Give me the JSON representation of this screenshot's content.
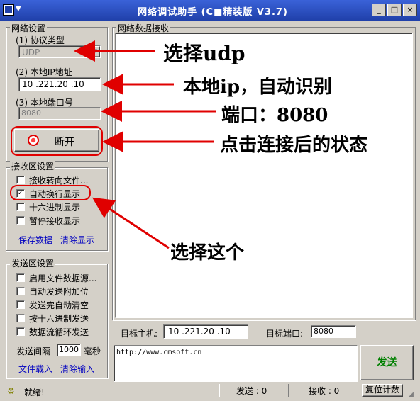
{
  "window": {
    "title": "网络调试助手 (C■精装版 V3.7)"
  },
  "settings": {
    "group_title": "网络设置",
    "protocol_label": "(1) 协议类型",
    "protocol_value": "UDP",
    "local_ip_label": "(2) 本地IP地址",
    "local_ip_value": "10 .221.20 .10",
    "local_port_label": "(3) 本地端口号",
    "local_port_value": "8080",
    "connect_button": "断开"
  },
  "receive": {
    "group_title": "接收区设置",
    "options": [
      "接收转向文件...",
      "自动换行显示",
      "十六进制显示",
      "暂停接收显示"
    ],
    "checked": [
      false,
      true,
      false,
      false
    ],
    "save_link": "保存数据",
    "clear_link": "清除显示"
  },
  "send": {
    "group_title": "发送区设置",
    "options": [
      "启用文件数据源...",
      "自动发送附加位",
      "发送完自动清空",
      "按十六进制发送",
      "数据流循环发送"
    ],
    "checked": [
      false,
      false,
      false,
      false,
      false
    ],
    "interval_label": "发送间隔",
    "interval_value": "1000",
    "interval_unit": "毫秒",
    "load_link": "文件载入",
    "clear_link": "清除输入"
  },
  "data_area": {
    "title": "网络数据接收"
  },
  "target": {
    "host_label": "目标主机:",
    "host_value": "10 .221.20 .10",
    "port_label": "目标端口:",
    "port_value": "8080"
  },
  "send_input": {
    "value": "http://www.cmsoft.cn"
  },
  "send_button": "发送",
  "status": {
    "ready": "就绪!",
    "sent_label": "发送 : 0",
    "recv_label": "接收 : 0",
    "reset_button": "复位计数"
  },
  "annotations": {
    "select_udp": "选择udp",
    "local_ip": "本地ip，自动识别",
    "port": "端口：8080",
    "after_connect": "点击连接后的状态",
    "select_this": "选择这个"
  },
  "colors": {
    "annotation_red": "#e00000",
    "send_text": "#008000",
    "title_bar": "#1f3fa8"
  }
}
